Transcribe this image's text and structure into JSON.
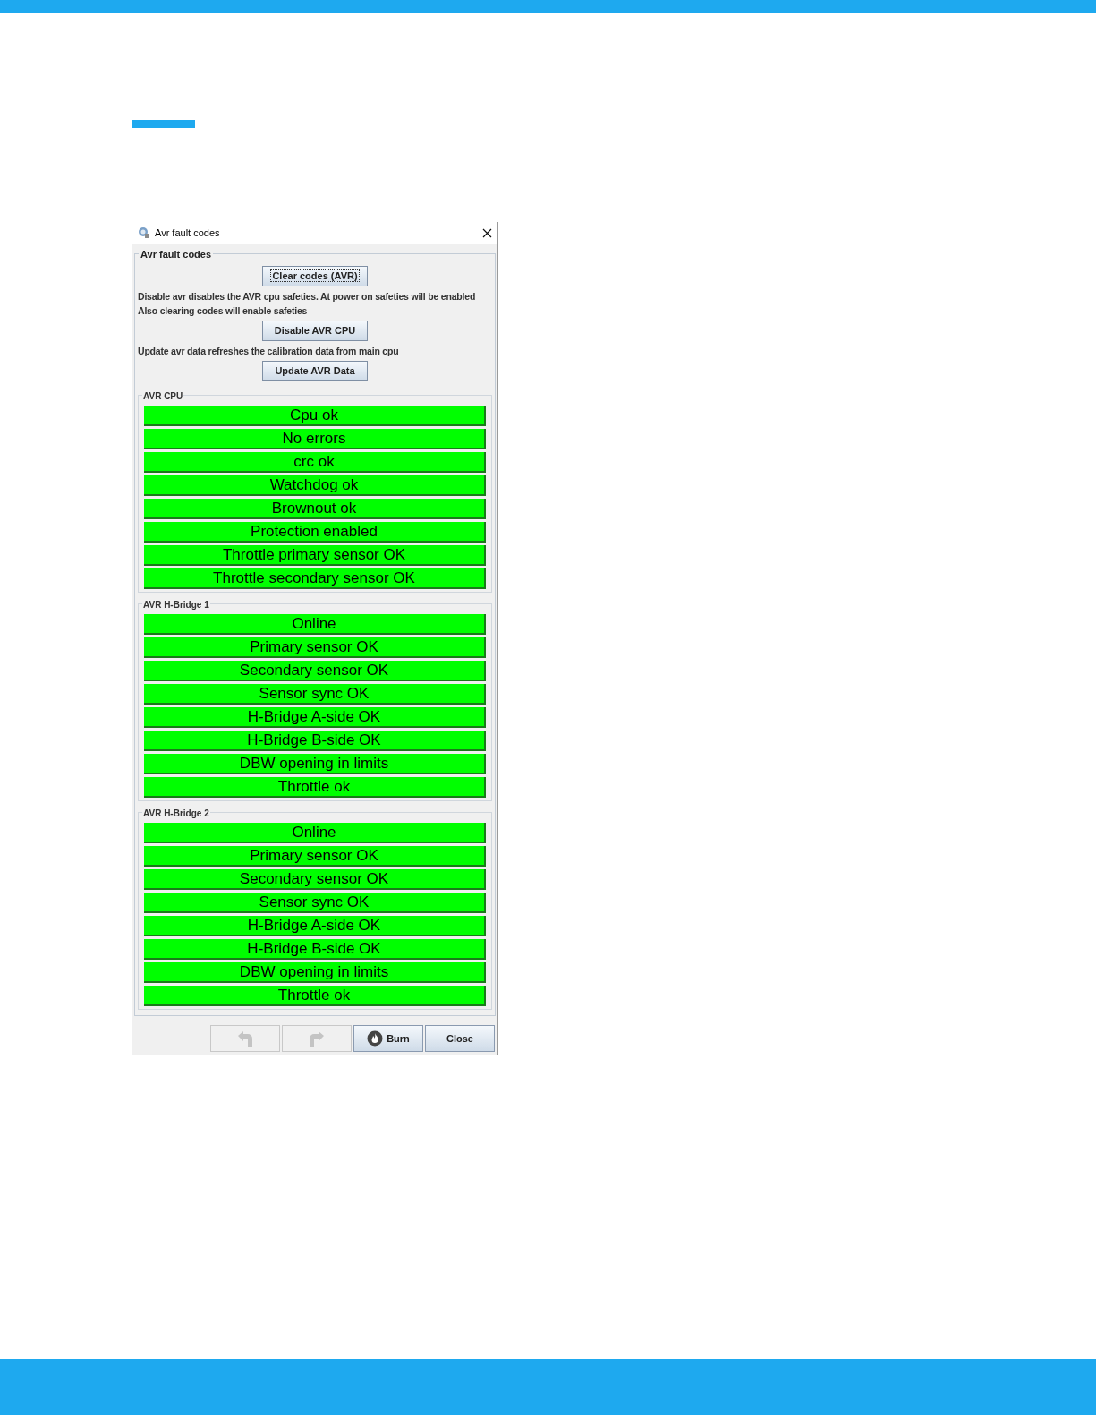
{
  "window": {
    "title": "Avr fault codes"
  },
  "group": {
    "title": "Avr fault codes",
    "items": [
      {
        "kind": "button",
        "label": "Clear codes (AVR)",
        "focused": true
      },
      {
        "kind": "text",
        "text": "Disable avr disables the AVR cpu safeties. At power on safeties will be enabled"
      },
      {
        "kind": "text",
        "text": "Also clearing codes will enable safeties"
      },
      {
        "kind": "button",
        "label": "Disable AVR CPU",
        "focused": false
      },
      {
        "kind": "text",
        "text": "Update avr data refreshes the calibration data from main cpu"
      },
      {
        "kind": "button",
        "label": "Update AVR Data",
        "focused": false
      }
    ]
  },
  "sections": [
    {
      "title": "AVR CPU",
      "indicators": [
        {
          "label": "Cpu ok",
          "ok": true
        },
        {
          "label": "No errors",
          "ok": true
        },
        {
          "label": "crc ok",
          "ok": true
        },
        {
          "label": "Watchdog ok",
          "ok": true
        },
        {
          "label": "Brownout ok",
          "ok": true
        },
        {
          "label": "Protection enabled",
          "ok": true
        },
        {
          "label": "Throttle primary sensor OK",
          "ok": true
        },
        {
          "label": "Throttle secondary sensor OK",
          "ok": true
        }
      ]
    },
    {
      "title": "AVR H-Bridge 1",
      "indicators": [
        {
          "label": "Online",
          "ok": true
        },
        {
          "label": "Primary sensor OK",
          "ok": true
        },
        {
          "label": "Secondary sensor OK",
          "ok": true
        },
        {
          "label": "Sensor sync OK",
          "ok": true
        },
        {
          "label": "H-Bridge A-side OK",
          "ok": true
        },
        {
          "label": "H-Bridge B-side OK",
          "ok": true
        },
        {
          "label": "DBW opening in limits",
          "ok": true
        },
        {
          "label": "Throttle ok",
          "ok": true
        }
      ]
    },
    {
      "title": "AVR H-Bridge 2",
      "indicators": [
        {
          "label": "Online",
          "ok": true
        },
        {
          "label": "Primary sensor OK",
          "ok": true
        },
        {
          "label": "Secondary sensor OK",
          "ok": true
        },
        {
          "label": "Sensor sync OK",
          "ok": true
        },
        {
          "label": "H-Bridge A-side OK",
          "ok": true
        },
        {
          "label": "H-Bridge B-side OK",
          "ok": true
        },
        {
          "label": "DBW opening in limits",
          "ok": true
        },
        {
          "label": "Throttle ok",
          "ok": true
        }
      ]
    }
  ],
  "footer": [
    {
      "kind": "undo",
      "disabled": true
    },
    {
      "kind": "redo",
      "disabled": true
    },
    {
      "kind": "burn",
      "label": "Burn",
      "disabled": false
    },
    {
      "kind": "close",
      "label": "Close",
      "disabled": false
    }
  ]
}
